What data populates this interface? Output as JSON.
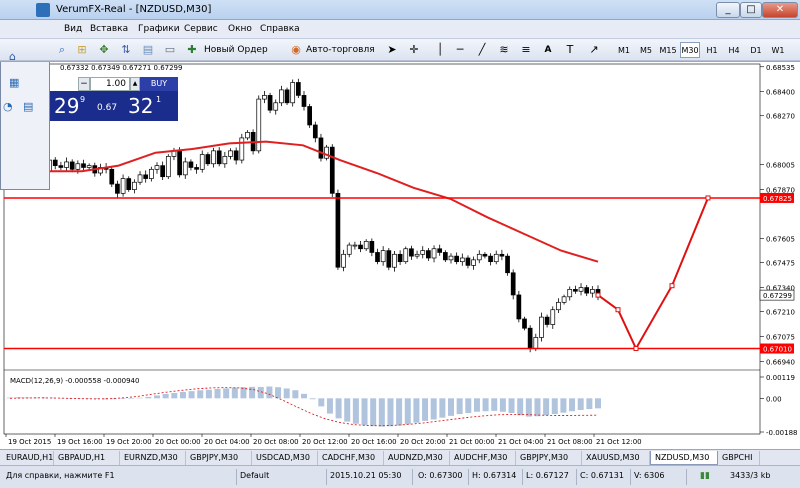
{
  "window": {
    "title": "VerumFX-Real - [NZDUSD,M30]",
    "minimize": "_",
    "maximize": "□",
    "close": "✕"
  },
  "menu": [
    "Вид",
    "Вставка",
    "Графики",
    "Сервис",
    "Окно",
    "Справка"
  ],
  "toolbar": {
    "new_order": "Новый Ордер",
    "auto_trading": "Авто-торговля",
    "timeframes": [
      "M1",
      "M5",
      "M15",
      "M30",
      "H1",
      "H4",
      "D1",
      "W1"
    ],
    "active_timeframe": "M30"
  },
  "chart_header": "0.67332 0.67349 0.67271 0.67299",
  "trade_panel": {
    "minus": "−",
    "volume": "1.00",
    "buy_label": "BUY",
    "sell_big": "29",
    "sell_sup": "9",
    "buy_small": "0.67",
    "buy_big": "32",
    "buy_sup": "1"
  },
  "chart_data": {
    "type": "candlestick",
    "symbol": "NZDUSD",
    "timeframe": "M30",
    "y_range": [
      0.6691,
      0.6855
    ],
    "price_ticks": [
      "0.68535",
      "0.68400",
      "0.68270",
      "0.68005",
      "0.67870",
      "0.67605",
      "0.67475",
      "0.67340",
      "0.67210",
      "0.67075",
      "0.66940"
    ],
    "highlighted_levels": [
      {
        "label": "0.67825",
        "value": 0.67825
      },
      {
        "label": "0.67010",
        "value": 0.6701
      }
    ],
    "current_price_label": "0.67299",
    "current_price": 0.67299,
    "time_labels": [
      "19 Oct 2015",
      "19 Oct 16:00",
      "19 Oct 20:00",
      "20 Oct 00:00",
      "20 Oct 04:00",
      "20 Oct 08:00",
      "20 Oct 12:00",
      "20 Oct 16:00",
      "20 Oct 20:00",
      "21 Oct 00:00",
      "21 Oct 04:00",
      "21 Oct 08:00",
      "21 Oct 12:00"
    ],
    "candle_closes": [
      0.6798,
      0.6802,
      0.68,
      0.6804,
      0.6799,
      0.6801,
      0.6797,
      0.6803,
      0.68,
      0.6799,
      0.6802,
      0.6798,
      0.6801,
      0.6799,
      0.68,
      0.6796,
      0.6799,
      0.6798,
      0.679,
      0.6785,
      0.6793,
      0.6787,
      0.6791,
      0.6795,
      0.6793,
      0.6798,
      0.68,
      0.6794,
      0.6805,
      0.6808,
      0.6795,
      0.6802,
      0.6799,
      0.6798,
      0.6806,
      0.6801,
      0.6808,
      0.6801,
      0.6805,
      0.6808,
      0.6803,
      0.6815,
      0.6818,
      0.6808,
      0.6836,
      0.6838,
      0.683,
      0.6834,
      0.6841,
      0.6834,
      0.6845,
      0.6838,
      0.6832,
      0.6822,
      0.6815,
      0.6804,
      0.681,
      0.6785,
      0.6745,
      0.6752,
      0.6757,
      0.6757,
      0.6755,
      0.6759,
      0.6753,
      0.6748,
      0.6754,
      0.6745,
      0.6752,
      0.6748,
      0.6755,
      0.6751,
      0.6752,
      0.6754,
      0.675,
      0.6755,
      0.6753,
      0.6749,
      0.6751,
      0.6748,
      0.675,
      0.6746,
      0.6749,
      0.6752,
      0.6751,
      0.6748,
      0.6752,
      0.6751,
      0.6742,
      0.673,
      0.6717,
      0.6712,
      0.6701,
      0.6707,
      0.6718,
      0.6714,
      0.6722,
      0.6726,
      0.6729,
      0.6733,
      0.6732,
      0.6734,
      0.6731,
      0.6733,
      0.6729
    ],
    "moving_average": [
      0.6798,
      0.6797,
      0.6797,
      0.68,
      0.6807,
      0.6809,
      0.6812,
      0.6813,
      0.6811,
      0.6803,
      0.6796,
      0.6788,
      0.6782,
      0.6772,
      0.6763,
      0.6754,
      0.6748
    ],
    "projection_path": [
      0.67299,
      0.6722,
      0.6701,
      0.6735,
      0.67825
    ],
    "macd": {
      "label": "MACD(12,26,9) -0.000558 -0.000940",
      "ticks": [
        "0.00119",
        "0.00",
        "-0.00188"
      ],
      "histogram": [
        4e-05,
        6e-05,
        5e-05,
        4e-05,
        5e-05,
        4e-05,
        2e-05,
        1e-05,
        -1e-05,
        -3e-05,
        -4e-05,
        -6e-05,
        -5e-05,
        -3e-05,
        -2e-05,
        3e-05,
        8e-05,
        0.00016,
        0.00024,
        0.0003,
        0.00036,
        0.0004,
        0.00045,
        0.00048,
        0.00052,
        0.00055,
        0.0006,
        0.00062,
        0.00064,
        0.00063,
        0.00066,
        0.00062,
        0.00055,
        0.00045,
        0.00025,
        -5e-05,
        -0.00045,
        -0.00085,
        -0.00112,
        -0.0013,
        -0.00142,
        -0.0015,
        -0.00155,
        -0.00158,
        -0.00156,
        -0.00152,
        -0.00145,
        -0.00136,
        -0.00126,
        -0.00118,
        -0.00108,
        -0.00098,
        -0.00088,
        -0.00082,
        -0.00075,
        -0.00072,
        -0.0007,
        -0.00075,
        -0.00082,
        -0.00095,
        -0.00102,
        -0.001,
        -0.00095,
        -0.00088,
        -0.0008,
        -0.00072,
        -0.00065,
        -0.0006,
        -0.00056
      ],
      "signal": [
        0.0,
        2e-05,
        3e-05,
        2e-05,
        0.0,
        -2e-05,
        -3e-05,
        -2e-05,
        3e-05,
        0.00012,
        0.00024,
        0.00035,
        0.00045,
        0.00053,
        0.00058,
        0.0006,
        0.00058,
        0.00048,
        0.00025,
        -0.0001,
        -0.00048,
        -0.00085,
        -0.00115,
        -0.00135,
        -0.00147,
        -0.00152,
        -0.00153,
        -0.0015,
        -0.00144,
        -0.00136,
        -0.00126,
        -0.00116,
        -0.00106,
        -0.00098,
        -0.00092,
        -0.0009,
        -0.00091,
        -0.00094,
        -0.00096,
        -0.00096,
        -0.00095,
        -0.00094
      ]
    }
  },
  "symbol_tabs": [
    "EURAUD,H1",
    "GBPAUD,H1",
    "EURNZD,M30",
    "GBPJPY,M30",
    "USDCAD,M30",
    "CADCHF,M30",
    "AUDNZD,M30",
    "AUDCHF,M30",
    "GBPJPY,M30",
    "XAUUSD,M30",
    "NZDUSD,M30",
    "GBPCHI"
  ],
  "active_tab": "NZDUSD,M30",
  "status": {
    "help": "Для справки, нажмите F1",
    "profile": "Default",
    "datetime": "2015.10.21 05:30",
    "open": "O: 0.67300",
    "high": "H: 0.67314",
    "low": "L: 0.67127",
    "close": "C: 0.67131",
    "volume": "V: 6306",
    "traffic": "3433/3 kb"
  }
}
